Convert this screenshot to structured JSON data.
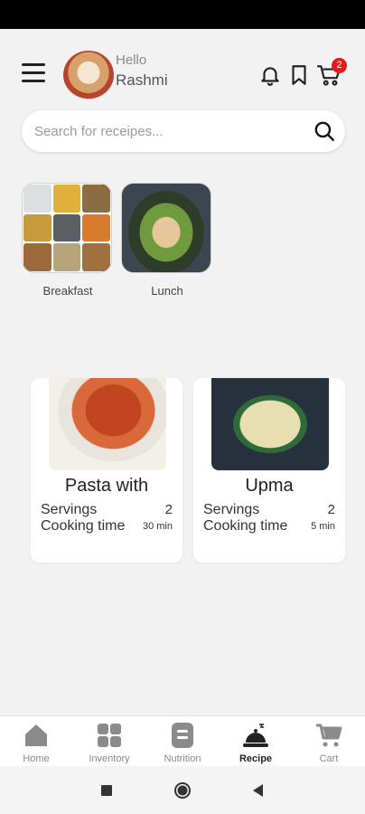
{
  "header": {
    "greeting": "Hello",
    "user_name": "Rashmi",
    "cart_count": "2",
    "icons": [
      "menu-icon",
      "bell-icon",
      "bookmark-icon",
      "cart-icon"
    ]
  },
  "search": {
    "placeholder": "Search for receipes...",
    "value": ""
  },
  "categories": [
    {
      "label": "Breakfast"
    },
    {
      "label": "Lunch"
    }
  ],
  "recipes": [
    {
      "title": "Pasta with",
      "servings_label": "Servings",
      "servings_value": "2",
      "time_label": "Cooking time",
      "time_value": "30 min"
    },
    {
      "title": "Upma",
      "servings_label": "Servings",
      "servings_value": "2",
      "time_label": "Cooking time",
      "time_value": "5 min"
    }
  ],
  "bottom_nav": [
    {
      "label": "Home",
      "icon": "home-icon"
    },
    {
      "label": "Inventory",
      "icon": "grid-icon"
    },
    {
      "label": "Nutrition",
      "icon": "notes-icon"
    },
    {
      "label": "Recipe",
      "icon": "cloche-icon",
      "active": true
    },
    {
      "label": "Cart",
      "icon": "cart-icon"
    }
  ],
  "colors": {
    "badge": "#e21b1b",
    "background": "#f2f2f2",
    "nav_active": "#222222",
    "nav_inactive": "#888888"
  }
}
